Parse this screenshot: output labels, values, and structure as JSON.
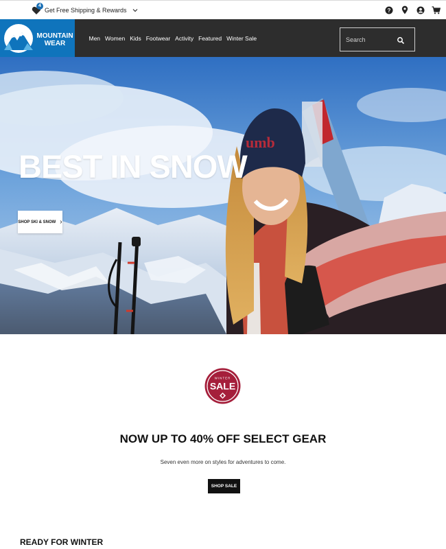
{
  "topbar": {
    "promo_badge": "4",
    "promo_label": "Get Free Shipping & Rewards",
    "icons": [
      "help-icon",
      "location-icon",
      "account-icon",
      "cart-icon"
    ]
  },
  "brand": {
    "line1": "MOUNTAIN",
    "line2": "WEAR",
    "color": "#0f74bc"
  },
  "nav": {
    "items": [
      "Men",
      "Women",
      "Kids",
      "Footwear",
      "Activity",
      "Featured",
      "Winter Sale"
    ]
  },
  "search": {
    "placeholder": "Search"
  },
  "hero": {
    "title": "BEST IN SNOW",
    "cta": "SHOP SKI & SNOW",
    "beanie_text": "umb"
  },
  "sale": {
    "badge_top": "WINTER",
    "badge_main": "SALE",
    "badge_color": "#a51f3b",
    "headline": "NOW UP TO 40% OFF SELECT GEAR",
    "subtext": "Seven even more on styles for adventures to come.",
    "cta": "SHOP SALE"
  },
  "section": {
    "title": "READY FOR WINTER"
  }
}
